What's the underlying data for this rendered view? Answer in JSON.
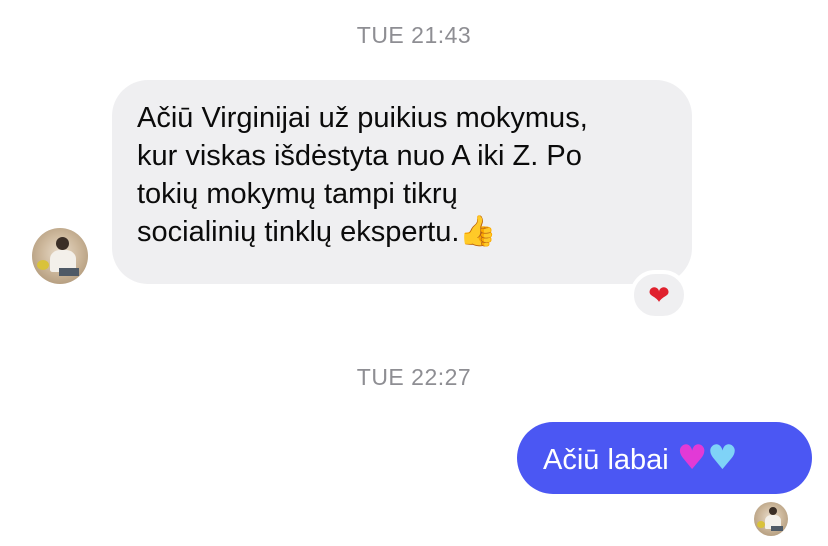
{
  "thread": {
    "timestamp_1": "TUE 21:43",
    "timestamp_2": "TUE 22:27"
  },
  "incoming": {
    "lines": [
      "Ačiū Virginijai už puikius mokymus,",
      "kur viskas išdėstyta nuo A iki Z. Po",
      "tokių mokymų tampi tikrų",
      "socialinių tinklų ekspertu."
    ],
    "trailing_emoji": "👍",
    "trailing_emoji_icon": "thumbs-up-icon",
    "reaction": "❤",
    "reaction_icon": "red-heart-icon"
  },
  "outgoing": {
    "text": "Ačiū labai ",
    "emoji_1": "♥",
    "emoji_1_icon": "pink-heart-icon",
    "emoji_2": "♥",
    "emoji_2_icon": "light-blue-heart-icon"
  },
  "colors": {
    "incoming_bubble": "#efeff1",
    "outgoing_bubble": "#4b57f3",
    "timestamp_text": "#8e8e93",
    "reaction_heart": "#e0212e"
  }
}
